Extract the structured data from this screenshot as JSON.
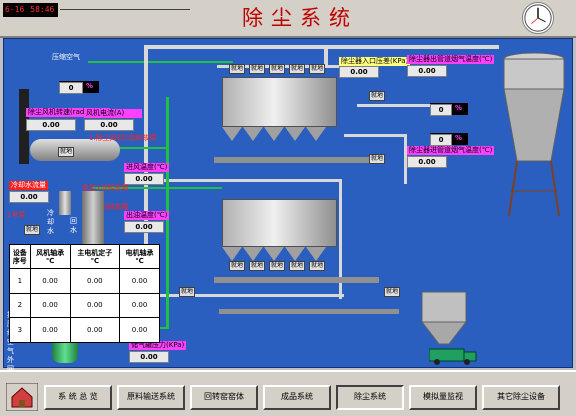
{
  "header": {
    "date": "6-16",
    "time": "58:46",
    "title": "除尘系统"
  },
  "process": {
    "compressed_air": "压缩空气",
    "fan_speed_label": "除尘风机转速(rad/min)",
    "fan_current_label": "风机电流(A)",
    "fan_speed_value": "0.00",
    "fan_current_value": "0.00",
    "top_value": "0",
    "top_unit": "%",
    "alarm_text": "1:除尘风机1动转故障",
    "inlet_temp_label": "进风温度(℃)",
    "inlet_temp_value": "0.00",
    "cooling_water_label": "冷却水流量",
    "cooling_water_value": "0.00",
    "fault_a": "电控1动转故障",
    "fault_b": "控制1动转故障",
    "outlet_temp_label": "出油温度(℃)",
    "outlet_temp_value": "0.00",
    "pump_label": "1号泵",
    "cooling_vertical": "冷却水",
    "return_vertical": "回水",
    "pressure_label": "除尘器入口压差(KPa)",
    "pressure_value": "0.00",
    "outlet_gas_temp_label": "除尘器出管道烟气温度(℃)",
    "outlet_gas_temp_value": "0.00",
    "inlet_gas_temp_label": "除尘器进管道烟气温度(℃)",
    "inlet_gas_temp_value": "0.00",
    "right_value": "0",
    "right_unit": "%",
    "mid_value": "0",
    "mid_unit": "%",
    "gas_pressure_label": "储气罐压力(KPa)",
    "gas_pressure_value": "0.00",
    "tank_vertical": "接压缩空气外网",
    "local_label": "就地"
  },
  "table": {
    "headers": [
      "设备\n序号",
      "风机轴承\n℃",
      "主电机定子\n℃",
      "电机轴承\n℃"
    ],
    "rows": [
      [
        "1",
        "0.00",
        "0.00",
        "0.00"
      ],
      [
        "2",
        "0.00",
        "0.00",
        "0.00"
      ],
      [
        "3",
        "0.00",
        "0.00",
        "0.00"
      ]
    ]
  },
  "nav": {
    "items": [
      "系 统 总 览",
      "原料输送系统",
      "回转窑窑体",
      "成品系统",
      "除尘系统",
      "模拟量监视",
      "其它除尘设备"
    ],
    "active_index": 4
  },
  "colors": {
    "process_bg": "#2a5fbf",
    "alarm_red": "#ff2020",
    "pipe_green": "#20c040"
  }
}
